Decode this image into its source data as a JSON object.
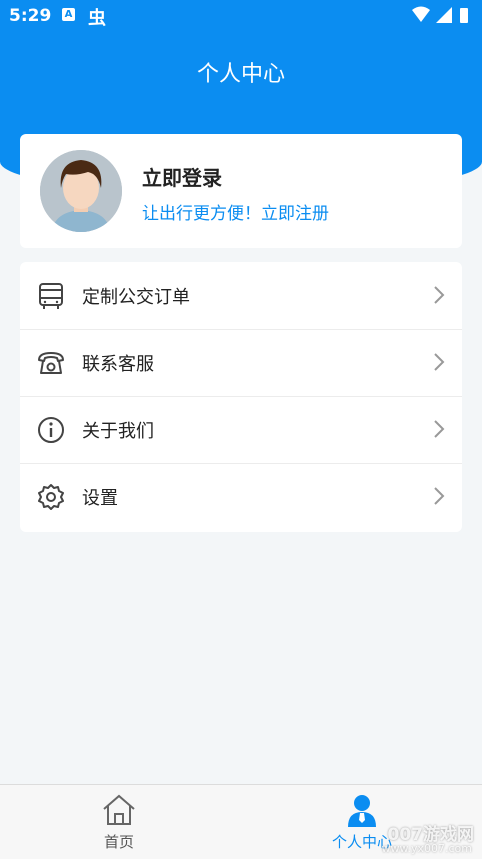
{
  "status_bar": {
    "time": "5:29",
    "notification_a": "A",
    "notification_bug": "虫"
  },
  "header": {
    "title": "个人中心"
  },
  "profile": {
    "login_title": "立即登录",
    "login_subtitle": "让出行更方便！立即注册"
  },
  "menu": {
    "items": [
      {
        "label": "定制公交订单",
        "icon": "bus-icon"
      },
      {
        "label": "联系客服",
        "icon": "telephone-icon"
      },
      {
        "label": "关于我们",
        "icon": "info-icon"
      },
      {
        "label": "设置",
        "icon": "gear-icon"
      }
    ]
  },
  "bottom_nav": {
    "items": [
      {
        "label": "首页",
        "icon": "home-icon",
        "active": false
      },
      {
        "label": "个人中心",
        "icon": "person-icon",
        "active": true
      }
    ]
  },
  "watermark": {
    "text": "007游戏网",
    "url": "www.yx007.com"
  },
  "colors": {
    "accent": "#0b8df1",
    "background": "#f3f6f8"
  }
}
